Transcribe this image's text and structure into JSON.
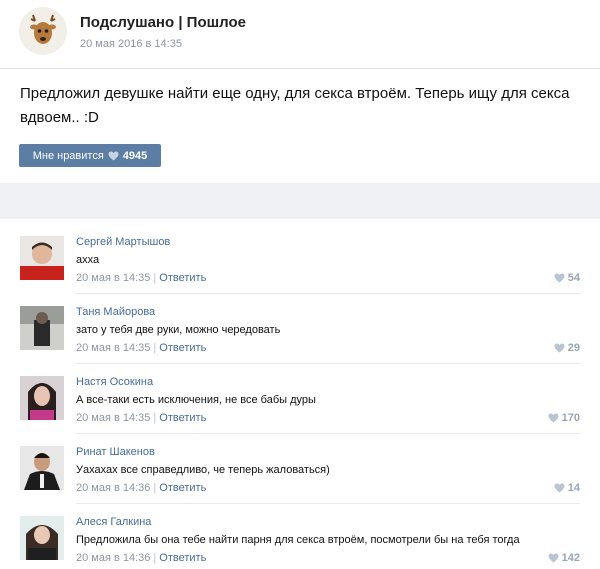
{
  "post": {
    "group_name": "Подслушано | Пошлое",
    "date": "20 мая 2016 в 14:35",
    "text": "Предложил девушке найти еще одну, для секса втроём. Теперь ищу для секса вдвоем.. :D",
    "like_label": "Мне нравится",
    "like_count": "4945"
  },
  "colors": {
    "accent": "#5c7ea5",
    "link": "#456c96",
    "muted": "#8d97a2",
    "band": "#eff1f4"
  },
  "comments": [
    {
      "author": "Сергей Мартышов",
      "text": "ахха",
      "date": "20 мая в 14:35",
      "reply": "Ответить",
      "likes": "54"
    },
    {
      "author": "Таня Майорова",
      "text": "зато у тебя две руки, можно чередовать",
      "date": "20 мая в 14:35",
      "reply": "Ответить",
      "likes": "29"
    },
    {
      "author": "Настя Осокина",
      "text": "А все-таки есть исключения, не все бабы дуры",
      "date": "20 мая в 14:35",
      "reply": "Ответить",
      "likes": "170"
    },
    {
      "author": "Ринат Шакенов",
      "text": "Уахахах все справедливо, че теперь жаловаться)",
      "date": "20 мая в 14:36",
      "reply": "Ответить",
      "likes": "14"
    },
    {
      "author": "Алеся Галкина",
      "text": "Предложила бы она тебе найти парня для секса втроём, посмотрели бы на тебя тогда",
      "date": "20 мая в 14:36",
      "reply": "Ответить",
      "likes": "142"
    }
  ]
}
